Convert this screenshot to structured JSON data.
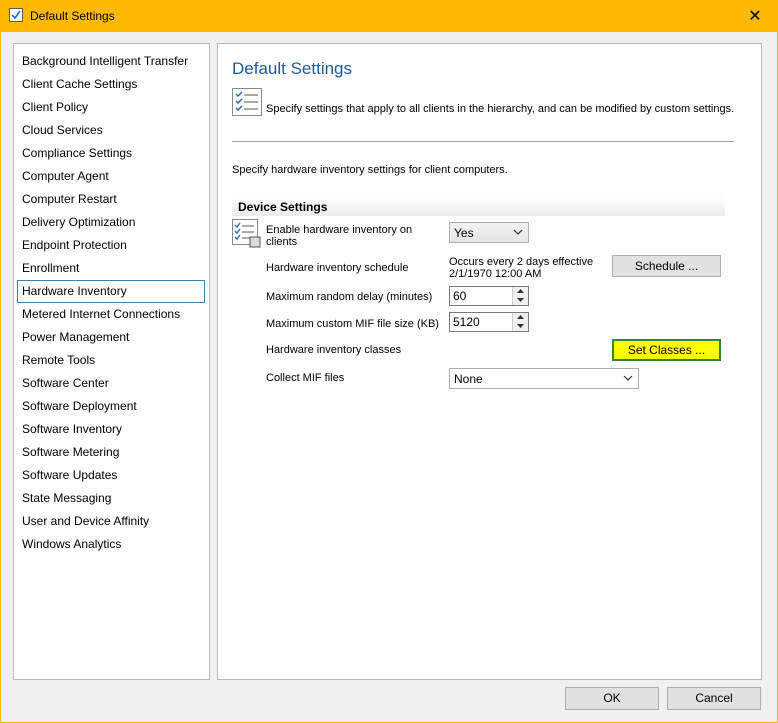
{
  "window": {
    "title": "Default Settings",
    "close_label": "✕"
  },
  "sidebar": {
    "items": [
      {
        "label": "Background Intelligent Transfer"
      },
      {
        "label": "Client Cache Settings"
      },
      {
        "label": "Client Policy"
      },
      {
        "label": "Cloud Services"
      },
      {
        "label": "Compliance Settings"
      },
      {
        "label": "Computer Agent"
      },
      {
        "label": "Computer Restart"
      },
      {
        "label": "Delivery Optimization"
      },
      {
        "label": "Endpoint Protection"
      },
      {
        "label": "Enrollment"
      },
      {
        "label": "Hardware Inventory"
      },
      {
        "label": "Metered Internet Connections"
      },
      {
        "label": "Power Management"
      },
      {
        "label": "Remote Tools"
      },
      {
        "label": "Software Center"
      },
      {
        "label": "Software Deployment"
      },
      {
        "label": "Software Inventory"
      },
      {
        "label": "Software Metering"
      },
      {
        "label": "Software Updates"
      },
      {
        "label": "State Messaging"
      },
      {
        "label": "User and Device Affinity"
      },
      {
        "label": "Windows Analytics"
      }
    ],
    "selected": "Hardware Inventory"
  },
  "main": {
    "title": "Default Settings",
    "header_description": "Specify settings that apply to all clients in the hierarchy, and can be modified by custom settings.",
    "intro": "Specify hardware inventory settings for client computers.",
    "section_title": "Device Settings",
    "enable": {
      "label_line1": "Enable hardware inventory on",
      "label_line2": "clients",
      "value": "Yes"
    },
    "schedule": {
      "label": "Hardware inventory schedule",
      "value_line1": "Occurs every 2 days effective",
      "value_line2": "2/1/1970 12:00 AM",
      "button": "Schedule ..."
    },
    "random_delay": {
      "label": "Maximum random delay (minutes)",
      "value": "60"
    },
    "mif_size": {
      "label": "Maximum custom MIF file size (KB)",
      "value": "5120"
    },
    "classes": {
      "label": "Hardware inventory classes",
      "button": "Set Classes ..."
    },
    "collect_mif": {
      "label": "Collect MIF files",
      "value": "None"
    }
  },
  "footer": {
    "ok": "OK",
    "cancel": "Cancel"
  },
  "colors": {
    "title_bar": "#ffb900",
    "title_text_blue": "#1c5a98",
    "highlight": "#ffff00",
    "highlight_border": "#2c8c2c"
  }
}
